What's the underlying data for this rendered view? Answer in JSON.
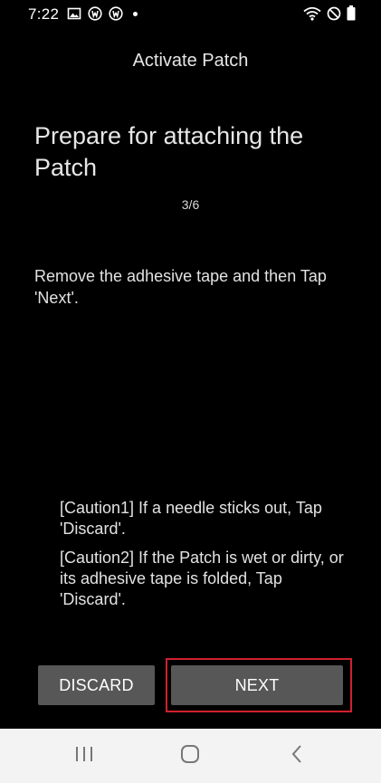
{
  "status_bar": {
    "time": "7:22",
    "left_icons": [
      "gallery-icon",
      "app-notification-icon",
      "app-notification-icon",
      "more-dot-icon"
    ],
    "right_icons": [
      "wifi-icon",
      "do-not-disturb-icon",
      "battery-icon"
    ]
  },
  "header": {
    "title": "Activate Patch"
  },
  "step": {
    "title": "Prepare for attaching the Patch",
    "counter": "3/6",
    "instruction": "Remove the adhesive tape and then Tap 'Next'."
  },
  "cautions": [
    "[Caution1] If a needle sticks out, Tap 'Discard'.",
    "[Caution2] If the Patch is wet or dirty, or its adhesive tape is folded, Tap 'Discard'."
  ],
  "buttons": {
    "discard_label": "DISCARD",
    "next_label": "NEXT"
  },
  "nav_bar": {
    "items": [
      "recents-icon",
      "home-icon",
      "back-icon"
    ]
  },
  "colors": {
    "background": "#000000",
    "button": "#575757",
    "highlight": "#d0212f",
    "nav_bar": "#f3f3f3"
  }
}
